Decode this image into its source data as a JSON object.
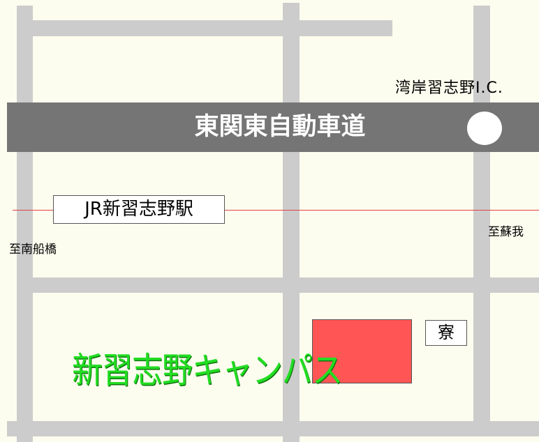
{
  "map": {
    "expressway_name": "東関東自動車道",
    "interchange_name": "湾岸習志野I.C.",
    "station_name": "JR新習志野駅",
    "direction_west": "至南船橋",
    "direction_east": "至蘇我",
    "campus_name": "新習志野キャンパス",
    "dormitory_name": "寮"
  },
  "colors": {
    "background": "#fdfdef",
    "road": "#cccccc",
    "expressway": "#757575",
    "railway": "#e04040",
    "dormitory": "#ff5555",
    "campus_text": "#22dd22"
  }
}
